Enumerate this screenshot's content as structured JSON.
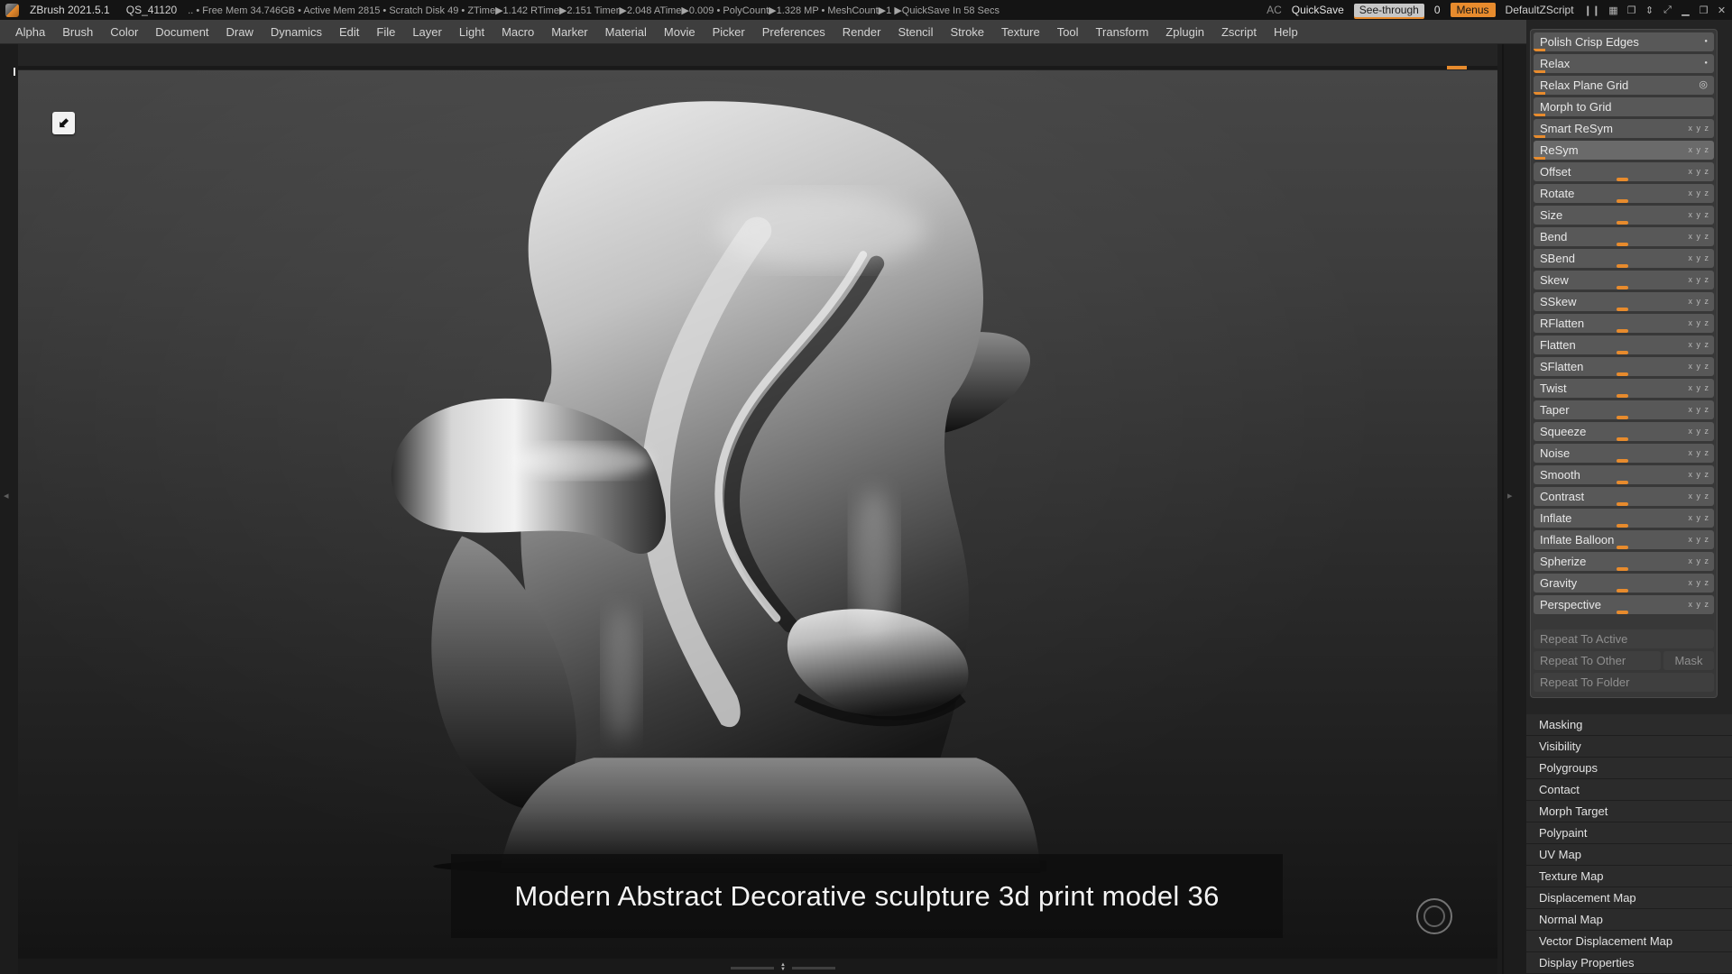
{
  "accent": "#e78b2d",
  "titlebar": {
    "app_title": "ZBrush 2021.5.1",
    "doc_name": "QS_41120",
    "stats": ".. • Free Mem 34.746GB • Active Mem 2815 • Scratch Disk 49 • ZTime▶1.142 RTime▶2.151 Timer▶2.048 ATime▶0.009 • PolyCount▶1.328 MP • MeshCount▶1 ▶QuickSave In 58 Secs",
    "ac_label": "AC",
    "quicksave_label": "QuickSave",
    "seethrough_label": "See-through",
    "seethrough_value": "0",
    "menus_label": "Menus",
    "script_label": "DefaultZScript"
  },
  "icons": {
    "pause": "❙❙",
    "grid": "▦",
    "windows": "❐",
    "updown": "⇕",
    "diag": "⤢",
    "minimize": "▁",
    "restore": "❒",
    "close": "✕",
    "dot": "●",
    "gear": "◎",
    "drop_arrow": "⬇",
    "left": "◂",
    "right": "▸",
    "up": "▲",
    "down": "▼"
  },
  "menubar": {
    "items": [
      "Alpha",
      "Brush",
      "Color",
      "Document",
      "Draw",
      "Dynamics",
      "Edit",
      "File",
      "Layer",
      "Light",
      "Macro",
      "Marker",
      "Material",
      "Movie",
      "Picker",
      "Preferences",
      "Render",
      "Stencil",
      "Stroke",
      "Texture",
      "Tool",
      "Transform",
      "Zplugin",
      "Zscript",
      "Help"
    ]
  },
  "canvas": {
    "caption": "Modern Abstract Decorative sculpture 3d print model 36"
  },
  "deformation": {
    "buttons": [
      {
        "label": "Polish Crisp Edges"
      },
      {
        "label": "Relax"
      },
      {
        "label": "Relax Plane Grid"
      },
      {
        "label": "Morph to Grid"
      },
      {
        "label": "Smart ReSym",
        "axes": "x y z"
      },
      {
        "label": "ReSym",
        "axes": "x y z"
      }
    ],
    "sliders": [
      {
        "label": "Offset",
        "axes": "x y z"
      },
      {
        "label": "Rotate",
        "axes": "x y z"
      },
      {
        "label": "Size",
        "axes": "x y z"
      },
      {
        "label": "Bend",
        "axes": "x y z"
      },
      {
        "label": "SBend",
        "axes": "x y z"
      },
      {
        "label": "Skew",
        "axes": "x y z"
      },
      {
        "label": "SSkew",
        "axes": "x y z"
      },
      {
        "label": "RFlatten",
        "axes": "x y z"
      },
      {
        "label": "Flatten",
        "axes": "x y z"
      },
      {
        "label": "SFlatten",
        "axes": "x y z"
      },
      {
        "label": "Twist",
        "axes": "x y z"
      },
      {
        "label": "Taper",
        "axes": "x y z"
      },
      {
        "label": "Squeeze",
        "axes": "x y z"
      },
      {
        "label": "Noise",
        "axes": "x y z"
      },
      {
        "label": "Smooth",
        "axes": "x y z"
      },
      {
        "label": "Contrast",
        "axes": "x y z"
      },
      {
        "label": "Inflate",
        "axes": "x y z"
      },
      {
        "label": "Inflate Balloon",
        "axes": "x y z"
      },
      {
        "label": "Spherize",
        "axes": "x y z"
      },
      {
        "label": "Gravity",
        "axes": "x y z"
      },
      {
        "label": "Perspective",
        "axes": "x y z"
      }
    ],
    "repeat_active": "Repeat To Active",
    "repeat_other": "Repeat To Other",
    "mask_label": "Mask",
    "repeat_folder": "Repeat To Folder"
  },
  "sections": {
    "items": [
      "Masking",
      "Visibility",
      "Polygroups",
      "Contact",
      "Morph Target",
      "Polypaint",
      "UV Map",
      "Texture Map",
      "Displacement Map",
      "Normal Map",
      "Vector Displacement Map",
      "Display Properties"
    ]
  }
}
